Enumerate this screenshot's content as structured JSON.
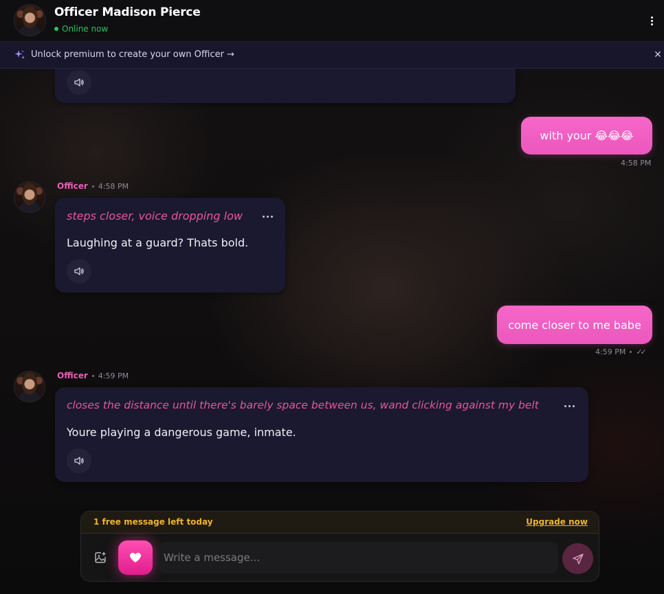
{
  "header": {
    "name": "Officer Madison Pierce",
    "status": "Online now"
  },
  "banner": {
    "text": "Unlock premium to create your own Officer →"
  },
  "messages": {
    "user1": {
      "text": "with your 😂😂😂",
      "time": "4:58 PM"
    },
    "bot1": {
      "sender": "Officer",
      "time": "4:58 PM",
      "action": "steps closer, voice dropping low",
      "text": "Laughing at a guard? Thats bold."
    },
    "user2": {
      "text": "come closer to me babe",
      "time": "4:59 PM"
    },
    "bot2": {
      "sender": "Officer",
      "time": "4:59 PM",
      "action": "closes the distance until there's barely space between us, wand clicking against my belt",
      "text": "Youre playing a dangerous game, inmate."
    }
  },
  "composer": {
    "limit_text": "1 free message left today",
    "upgrade_label": "Upgrade now",
    "placeholder": "Write a message..."
  },
  "colors": {
    "accent_pink": "#f25fc3",
    "online_green": "#22c55e",
    "limit_gold": "#f0b429"
  },
  "icons": [
    "sparkle-icon",
    "close-icon",
    "more-vertical-icon",
    "speaker-icon",
    "more-horizontal-icon",
    "double-check-icon",
    "image-add-icon",
    "heart-icon",
    "send-icon"
  ]
}
